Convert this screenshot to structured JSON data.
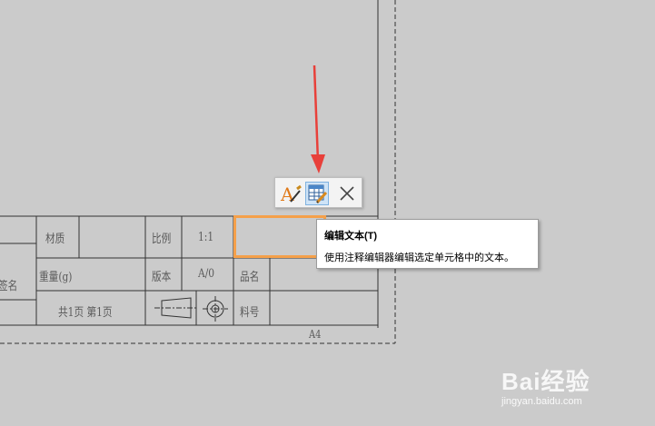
{
  "title_block": {
    "material_label": "材质",
    "scale_label": "比例",
    "scale_value": "1:1",
    "signature_label": "签名",
    "weight_label": "重量(g)",
    "version_label": "版本",
    "version_value": "A/0",
    "part_name_label": "品名",
    "page_info": "共1页 第1页",
    "part_number_label": "料号",
    "sheet_size": "A4"
  },
  "toolbar": {
    "items": [
      {
        "icon": "text-style-icon",
        "label": ""
      },
      {
        "icon": "edit-table-text-icon",
        "label": ""
      },
      {
        "icon": "close-icon",
        "label": ""
      }
    ]
  },
  "tooltip": {
    "title": "编辑文本(T)",
    "description": "使用注释编辑器编辑选定单元格中的文本。"
  },
  "watermark": {
    "brand": "Bai经验",
    "url": "jingyan.baidu.com"
  },
  "colors": {
    "canvas": "#cbcbcb",
    "highlight": "#f5a04a",
    "arrow": "#e8403a"
  }
}
